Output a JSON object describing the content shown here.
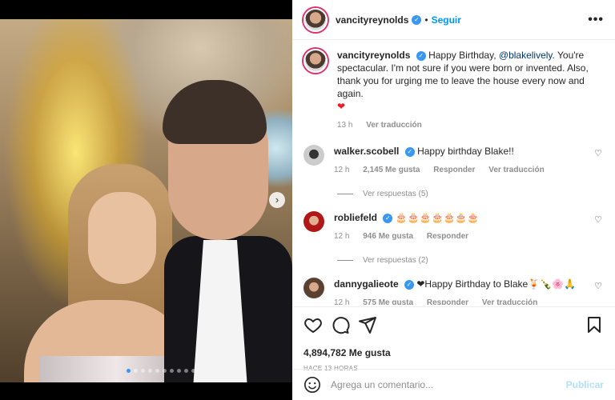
{
  "post": {
    "username": "vancityreynolds",
    "separator": "•",
    "follow_label": "Seguir",
    "more_label": "•••"
  },
  "caption": {
    "username": "vancityreynolds",
    "text_before": "Happy Birthday, ",
    "mention": "@blakelively",
    "text_after": ". You're spectacular. I'm not sure if you were born or invented. Also, thank you for urging me to leave the house every now and again.",
    "emoji": "❤",
    "time": "13 h",
    "translate": "Ver traducción"
  },
  "comments": [
    {
      "username": "walker.scobell",
      "text": "Happy birthday Blake!!",
      "time": "12 h",
      "likes": "2,145 Me gusta",
      "reply": "Responder",
      "translate": "Ver traducción",
      "replies": "Ver respuestas (5)"
    },
    {
      "username": "robliefeld",
      "text": "🎂🎂🎂🎂🎂🎂🎂",
      "time": "12 h",
      "likes": "946 Me gusta",
      "reply": "Responder",
      "replies": "Ver respuestas (2)"
    },
    {
      "username": "dannygalieote",
      "text": "❤Happy Birthday to Blake🍹🍾🌸🙏",
      "time": "12 h",
      "likes": "575 Me gusta",
      "reply": "Responder",
      "translate": "Ver traducción"
    }
  ],
  "footer": {
    "likes": "4,894,782 Me gusta",
    "time_ago": "HACE 13 HORAS",
    "comment_placeholder": "Agrega un comentario...",
    "post_label": "Publicar"
  },
  "carousel": {
    "next_label": "›",
    "dot_count": 10,
    "active_dot": 0
  },
  "colors": {
    "accent": "#0095f6",
    "verified": "#3897f0",
    "muted": "#8e8e8e",
    "heart": "#ed1c24",
    "post_disabled": "#b2dffc"
  }
}
